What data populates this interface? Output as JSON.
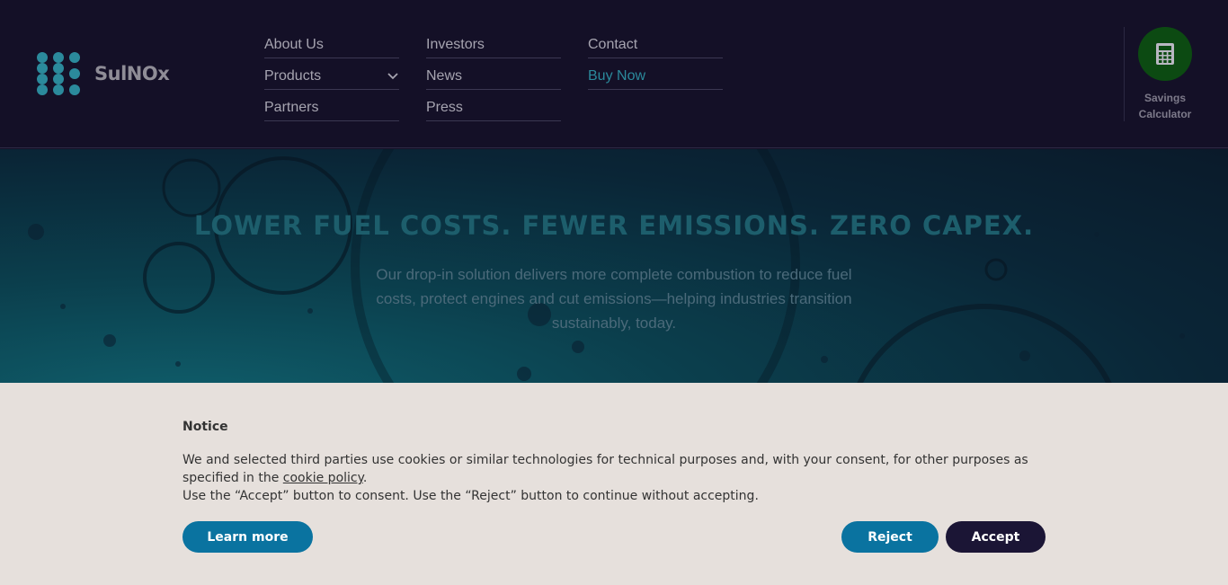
{
  "brand": {
    "name": "SulNOx"
  },
  "nav": {
    "col1": [
      "About Us",
      "Products",
      "Partners"
    ],
    "col2": [
      "Investors",
      "News",
      "Press"
    ],
    "col3": [
      "Contact",
      "Buy Now"
    ]
  },
  "calculator": {
    "label_line1": "Savings",
    "label_line2": "Calculator",
    "icon": "calculator-icon"
  },
  "hero": {
    "title": "LOWER FUEL COSTS. FEWER EMISSIONS. ZERO CAPEX.",
    "subtitle": "Our drop-in solution delivers more complete combustion to reduce fuel costs, protect engines and cut emissions—helping industries transition sustainably, today."
  },
  "notice": {
    "title": "Notice",
    "text_before_link": "We and selected third parties use cookies or similar technologies for technical purposes and, with your consent, for other purposes as specified in the ",
    "link_text": "cookie policy",
    "text_after_link": ".",
    "line2": "Use the “Accept” button to consent. Use the “Reject” button to continue without accepting.",
    "learn_more": "Learn more",
    "reject": "Reject",
    "accept": "Accept"
  },
  "colors": {
    "header_bg": "#141027",
    "accent_teal": "#2b8a9c",
    "button_blue": "#0a73a0",
    "button_dark": "#1b1535",
    "calculator_green": "#0c4a12"
  }
}
